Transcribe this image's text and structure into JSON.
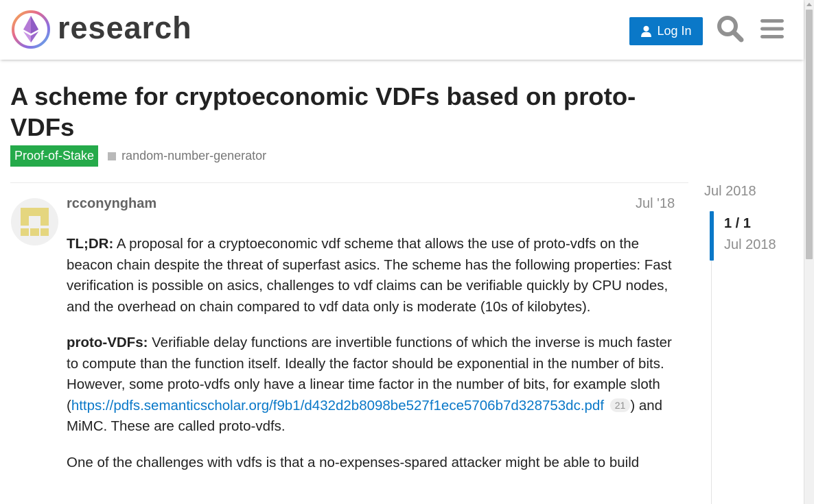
{
  "header": {
    "logo_text": "research",
    "login_label": "Log In",
    "icons": [
      "user-icon",
      "search-icon",
      "hamburger-menu-icon"
    ]
  },
  "topic": {
    "title": "A scheme for cryptoeconomic VDFs based on proto-VDFs",
    "category": "Proof-of-Stake",
    "tag": "random-number-generator",
    "colors": {
      "category": "#25aa4a",
      "accent": "#0a78c8",
      "tag_square": "#b9b9b9"
    }
  },
  "post": {
    "username": "rcconyngham",
    "date": "Jul '18",
    "p1_bold": "TL;DR:",
    "p1_text": " A proposal for a cryptoeconomic vdf scheme that allows the use of proto-vdfs on the beacon chain despite the threat of superfast asics. The scheme has the following properties: Fast verification is possible on asics, challenges to vdf claims can be verifiable quickly by CPU nodes, and the overhead on chain compared to vdf data only is moderate (10s of kilobytes).",
    "p2_bold": "proto-VDFs:",
    "p2_text": " Verifiable delay functions are invertible functions of which the inverse is much faster to compute than the function itself. Ideally the factor should be exponential in the number of bits. However, some proto-vdfs only have a linear time factor in the number of bits, for example sloth (",
    "p2_link": "https://pdfs.semanticscholar.org/f9b1/d432d2b8098be527f1ece5706b7d328753dc.pdf",
    "p2_link_clicks": "21",
    "p2_tail": ") and MiMC. These are called proto-vdfs.",
    "p3_text": "One of the challenges with vdfs is that a no-expenses-spared attacker might be able to build"
  },
  "timeline": {
    "start_date": "Jul 2018",
    "position": "1 / 1",
    "current_date": "Jul 2018"
  }
}
